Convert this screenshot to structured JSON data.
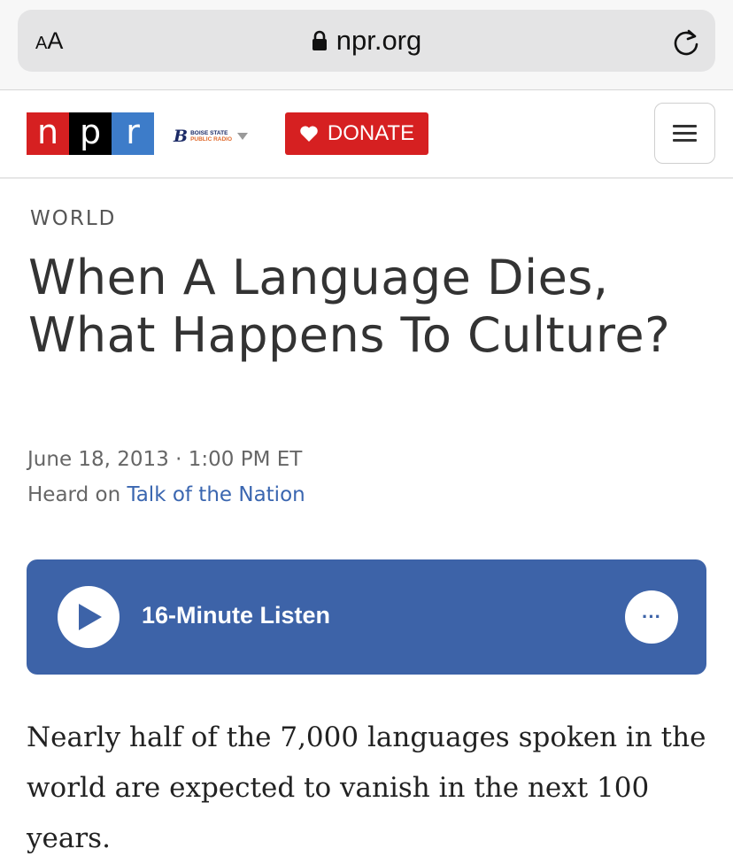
{
  "browser": {
    "text_size_label": "AA",
    "url": "npr.org"
  },
  "header": {
    "logo_letters": [
      "n",
      "p",
      "r"
    ],
    "logo_colors": [
      "#d62021",
      "#000000",
      "#3d7cc9"
    ],
    "station_line1": "BOISE STATE",
    "station_line2": "PUBLIC RADIO",
    "donate_label": "DONATE"
  },
  "article": {
    "section": "WORLD",
    "title": "When A Language Dies, What Happens To Culture?",
    "dateline": "June 18, 2013 · 1:00 PM ET",
    "heard_prefix": "Heard on",
    "program": "Talk of the Nation",
    "body": "Nearly half of the 7,000 languages spoken in the world are expected to vanish in the next 100 years."
  },
  "player": {
    "listen_label": "16-Minute Listen",
    "more_label": "···"
  },
  "colors": {
    "accent_blue": "#3d63a8",
    "donate_red": "#d62021",
    "link_blue": "#3a66b0"
  }
}
